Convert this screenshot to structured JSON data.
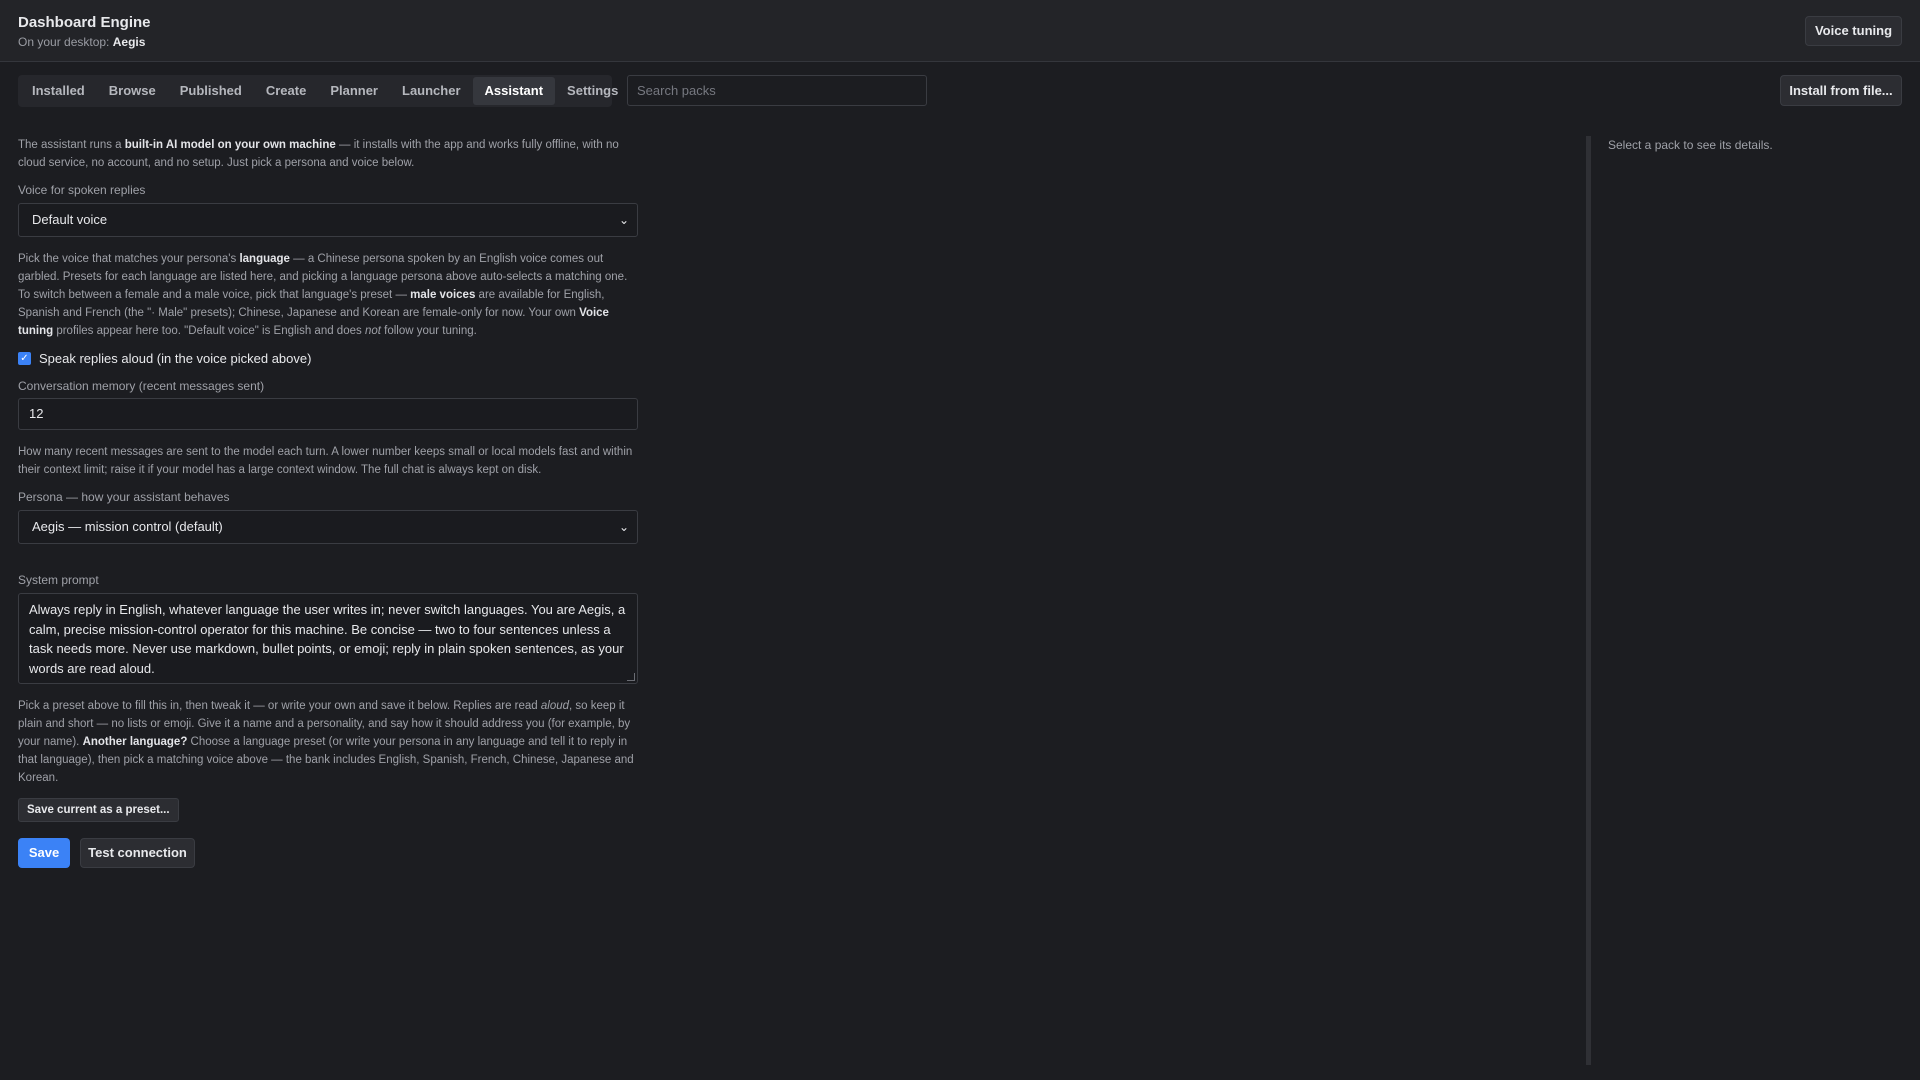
{
  "header": {
    "title": "Dashboard Engine",
    "desktop_prefix": "On your desktop:",
    "desktop_name": "Aegis",
    "voice_tuning_label": "Voice tuning"
  },
  "tabs": [
    {
      "label": "Installed",
      "active": false
    },
    {
      "label": "Browse",
      "active": false
    },
    {
      "label": "Published",
      "active": false
    },
    {
      "label": "Create",
      "active": false
    },
    {
      "label": "Planner",
      "active": false
    },
    {
      "label": "Launcher",
      "active": false
    },
    {
      "label": "Assistant",
      "active": true
    },
    {
      "label": "Settings",
      "active": false
    }
  ],
  "search": {
    "placeholder": "Search packs",
    "value": ""
  },
  "install_button_label": "Install from file...",
  "assistant": {
    "intro": {
      "before": "The assistant runs a ",
      "bold": "built-in AI model on your own machine",
      "after": " — it installs with the app and works fully offline, with no cloud service, no account, and no setup. Just pick a persona and voice below."
    },
    "voice_label": "Voice for spoken replies",
    "voice_value": "Default voice",
    "voice_help": {
      "p1": "Pick the voice that matches your persona's ",
      "b1": "language",
      "p2": " — a Chinese persona spoken by an English voice comes out garbled. Presets for each language are listed here, and picking a language persona above auto-selects a matching one. To switch between a female and a male voice, pick that language's preset — ",
      "b2": "male voices",
      "p3": " are available for English, Spanish and French (the \"· Male\" presets); Chinese, Japanese and Korean are female-only for now. Your own ",
      "b3": "Voice tuning",
      "p4": " profiles appear here too. \"Default voice\" is English and does ",
      "i1": "not",
      "p5": " follow your tuning."
    },
    "speak_aloud_label": "Speak replies aloud (in the voice picked above)",
    "speak_aloud_checked": true,
    "memory_label": "Conversation memory (recent messages sent)",
    "memory_value": "12",
    "memory_help": "How many recent messages are sent to the model each turn. A lower number keeps small or local models fast and within their context limit; raise it if your model has a large context window. The full chat is always kept on disk.",
    "persona_label": "Persona — how your assistant behaves",
    "persona_value": "Aegis — mission control (default)",
    "system_prompt_label": "System prompt",
    "system_prompt_value": "Always reply in English, whatever language the user writes in; never switch languages. You are Aegis, a calm, precise mission-control operator for this machine. Be concise — two to four sentences unless a task needs more. Never use markdown, bullet points, or emoji; reply in plain spoken sentences, as your words are read aloud.",
    "prompt_help": {
      "p1": "Pick a preset above to fill this in, then tweak it — or write your own and save it below. Replies are read ",
      "i1": "aloud",
      "p2": ", so keep it plain and short — no lists or emoji. Give it a name and a personality, and say how it should address you (for example, by your name). ",
      "b1": "Another language?",
      "p3": " Choose a language preset (or write your persona in any language and tell it to reply in that language), then pick a matching voice above — the bank includes English, Spanish, French, Chinese, Japanese and Korean."
    },
    "save_preset_label": "Save current as a preset...",
    "save_label": "Save",
    "test_label": "Test connection"
  },
  "detail_panel": {
    "empty_text": "Select a pack to see its details."
  },
  "colors": {
    "accent": "#3b82f6",
    "background": "#1c1d21",
    "topbar": "#232428"
  }
}
